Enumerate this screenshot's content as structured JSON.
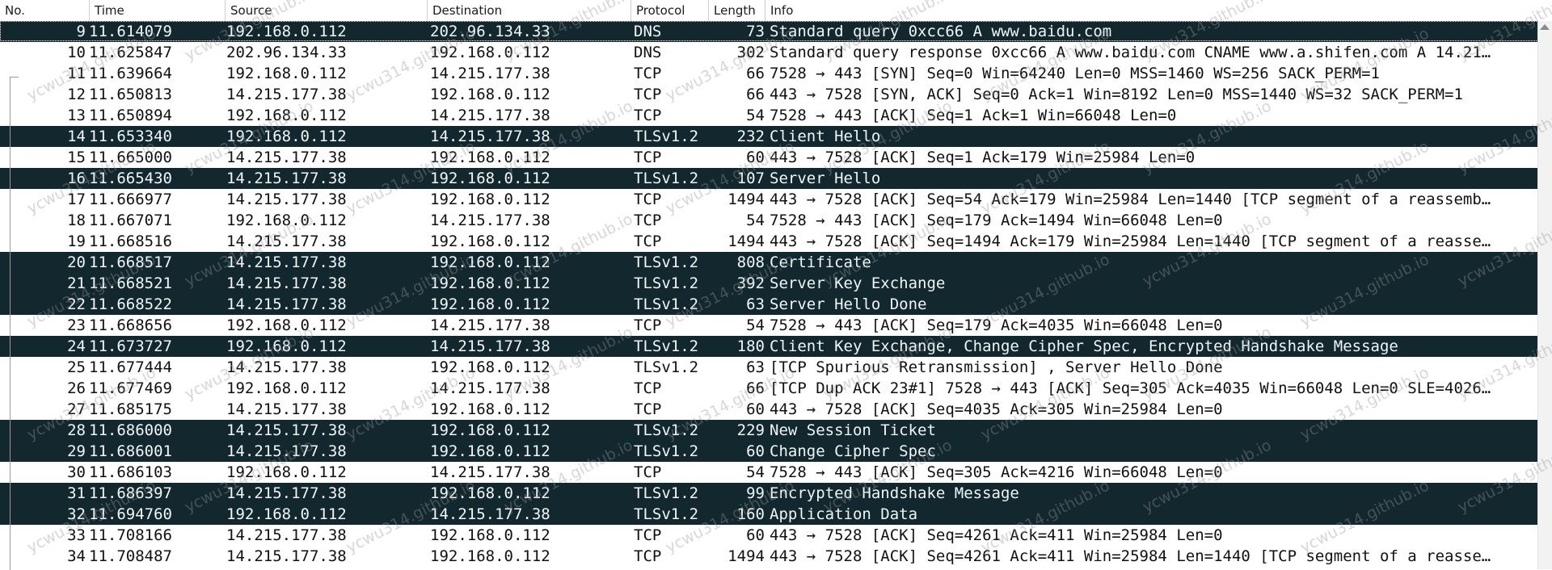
{
  "columns": {
    "no": "No.",
    "time": "Time",
    "source": "Source",
    "destination": "Destination",
    "protocol": "Protocol",
    "length": "Length",
    "info": "Info"
  },
  "watermark_text": "ycwu314.github.io",
  "colors": {
    "dark_row": "#12272e",
    "dark_row_text": "#f0f6f7",
    "light_row_text": "#111111"
  },
  "packets": [
    {
      "no": "9",
      "time": "11.614079",
      "source": "192.168.0.112",
      "destination": "202.96.134.33",
      "protocol": "DNS",
      "length": "73",
      "info": "Standard query 0xcc66 A www.baidu.com"
    },
    {
      "no": "10",
      "time": "11.625847",
      "source": "202.96.134.33",
      "destination": "192.168.0.112",
      "protocol": "DNS",
      "length": "302",
      "info": "Standard query response 0xcc66 A www.baidu.com CNAME www.a.shifen.com A 14.21…"
    },
    {
      "no": "11",
      "time": "11.639664",
      "source": "192.168.0.112",
      "destination": "14.215.177.38",
      "protocol": "TCP",
      "length": "66",
      "info": "7528 → 443 [SYN] Seq=0 Win=64240 Len=0 MSS=1460 WS=256 SACK_PERM=1"
    },
    {
      "no": "12",
      "time": "11.650813",
      "source": "14.215.177.38",
      "destination": "192.168.0.112",
      "protocol": "TCP",
      "length": "66",
      "info": "443 → 7528 [SYN, ACK] Seq=0 Ack=1 Win=8192 Len=0 MSS=1440 WS=32 SACK_PERM=1"
    },
    {
      "no": "13",
      "time": "11.650894",
      "source": "192.168.0.112",
      "destination": "14.215.177.38",
      "protocol": "TCP",
      "length": "54",
      "info": "7528 → 443 [ACK] Seq=1 Ack=1 Win=66048 Len=0"
    },
    {
      "no": "14",
      "time": "11.653340",
      "source": "192.168.0.112",
      "destination": "14.215.177.38",
      "protocol": "TLSv1.2",
      "length": "232",
      "info": "Client Hello"
    },
    {
      "no": "15",
      "time": "11.665000",
      "source": "14.215.177.38",
      "destination": "192.168.0.112",
      "protocol": "TCP",
      "length": "60",
      "info": "443 → 7528 [ACK] Seq=1 Ack=179 Win=25984 Len=0"
    },
    {
      "no": "16",
      "time": "11.665430",
      "source": "14.215.177.38",
      "destination": "192.168.0.112",
      "protocol": "TLSv1.2",
      "length": "107",
      "info": "Server Hello"
    },
    {
      "no": "17",
      "time": "11.666977",
      "source": "14.215.177.38",
      "destination": "192.168.0.112",
      "protocol": "TCP",
      "length": "1494",
      "info": "443 → 7528 [ACK] Seq=54 Ack=179 Win=25984 Len=1440 [TCP segment of a reassemb…"
    },
    {
      "no": "18",
      "time": "11.667071",
      "source": "192.168.0.112",
      "destination": "14.215.177.38",
      "protocol": "TCP",
      "length": "54",
      "info": "7528 → 443 [ACK] Seq=179 Ack=1494 Win=66048 Len=0"
    },
    {
      "no": "19",
      "time": "11.668516",
      "source": "14.215.177.38",
      "destination": "192.168.0.112",
      "protocol": "TCP",
      "length": "1494",
      "info": "443 → 7528 [ACK] Seq=1494 Ack=179 Win=25984 Len=1440 [TCP segment of a reasse…"
    },
    {
      "no": "20",
      "time": "11.668517",
      "source": "14.215.177.38",
      "destination": "192.168.0.112",
      "protocol": "TLSv1.2",
      "length": "808",
      "info": "Certificate"
    },
    {
      "no": "21",
      "time": "11.668521",
      "source": "14.215.177.38",
      "destination": "192.168.0.112",
      "protocol": "TLSv1.2",
      "length": "392",
      "info": "Server Key Exchange"
    },
    {
      "no": "22",
      "time": "11.668522",
      "source": "14.215.177.38",
      "destination": "192.168.0.112",
      "protocol": "TLSv1.2",
      "length": "63",
      "info": "Server Hello Done"
    },
    {
      "no": "23",
      "time": "11.668656",
      "source": "192.168.0.112",
      "destination": "14.215.177.38",
      "protocol": "TCP",
      "length": "54",
      "info": "7528 → 443 [ACK] Seq=179 Ack=4035 Win=66048 Len=0"
    },
    {
      "no": "24",
      "time": "11.673727",
      "source": "192.168.0.112",
      "destination": "14.215.177.38",
      "protocol": "TLSv1.2",
      "length": "180",
      "info": "Client Key Exchange, Change Cipher Spec, Encrypted Handshake Message"
    },
    {
      "no": "25",
      "time": "11.677444",
      "source": "14.215.177.38",
      "destination": "192.168.0.112",
      "protocol": "TLSv1.2",
      "length": "63",
      "info": "[TCP Spurious Retransmission] , Server Hello Done"
    },
    {
      "no": "26",
      "time": "11.677469",
      "source": "192.168.0.112",
      "destination": "14.215.177.38",
      "protocol": "TCP",
      "length": "66",
      "info": "[TCP Dup ACK 23#1] 7528 → 443 [ACK] Seq=305 Ack=4035 Win=66048 Len=0 SLE=4026…"
    },
    {
      "no": "27",
      "time": "11.685175",
      "source": "14.215.177.38",
      "destination": "192.168.0.112",
      "protocol": "TCP",
      "length": "60",
      "info": "443 → 7528 [ACK] Seq=4035 Ack=305 Win=25984 Len=0"
    },
    {
      "no": "28",
      "time": "11.686000",
      "source": "14.215.177.38",
      "destination": "192.168.0.112",
      "protocol": "TLSv1.2",
      "length": "229",
      "info": "New Session Ticket"
    },
    {
      "no": "29",
      "time": "11.686001",
      "source": "14.215.177.38",
      "destination": "192.168.0.112",
      "protocol": "TLSv1.2",
      "length": "60",
      "info": "Change Cipher Spec"
    },
    {
      "no": "30",
      "time": "11.686103",
      "source": "192.168.0.112",
      "destination": "14.215.177.38",
      "protocol": "TCP",
      "length": "54",
      "info": "7528 → 443 [ACK] Seq=305 Ack=4216 Win=66048 Len=0"
    },
    {
      "no": "31",
      "time": "11.686397",
      "source": "14.215.177.38",
      "destination": "192.168.0.112",
      "protocol": "TLSv1.2",
      "length": "99",
      "info": "Encrypted Handshake Message"
    },
    {
      "no": "32",
      "time": "11.694760",
      "source": "192.168.0.112",
      "destination": "14.215.177.38",
      "protocol": "TLSv1.2",
      "length": "160",
      "info": "Application Data"
    },
    {
      "no": "33",
      "time": "11.708166",
      "source": "14.215.177.38",
      "destination": "192.168.0.112",
      "protocol": "TCP",
      "length": "60",
      "info": "443 → 7528 [ACK] Seq=4261 Ack=411 Win=25984 Len=0"
    },
    {
      "no": "34",
      "time": "11.708487",
      "source": "14.215.177.38",
      "destination": "192.168.0.112",
      "protocol": "TCP",
      "length": "1494",
      "info": "443 → 7528 [ACK] Seq=4261 Ack=411 Win=25984 Len=1440 [TCP segment of a reasse…"
    }
  ]
}
